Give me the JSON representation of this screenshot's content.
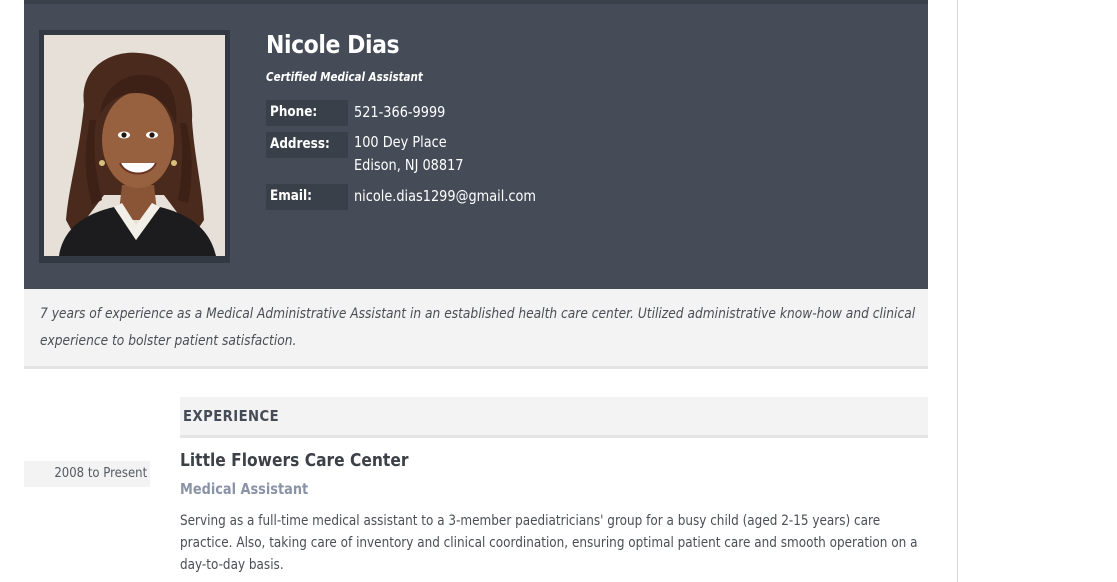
{
  "profile": {
    "name": "Nicole Dias",
    "title": "Certified Medical Assistant"
  },
  "contact": {
    "phone_label": "Phone:",
    "phone": "521-366-9999",
    "address_label": "Address:",
    "address_line1": "100 Dey Place",
    "address_line2": "Edison, NJ 08817",
    "email_label": "Email:",
    "email": "nicole.dias1299@gmail.com"
  },
  "summary": "7 years of experience as a Medical Administrative Assistant in an established health care center. Utilized administrative know-how and clinical experience to bolster patient satisfaction.",
  "experience": {
    "heading": "EXPERIENCE",
    "jobs": [
      {
        "dates": "2008 to Present",
        "company": "Little Flowers Care Center",
        "title": "Medical Assistant",
        "description": "Serving as a full-time medical assistant to a 3-member paediatricians' group for a busy child (aged 2-15 years) care practice. Also, taking care of inventory and clinical coordination, ensuring optimal patient care and smooth operation on a day-to-day basis."
      }
    ]
  },
  "colors": {
    "header_bg": "#454c58",
    "label_bg": "#3a404a",
    "summary_bg": "#f3f3f3",
    "job_title": "#8a93a6"
  }
}
